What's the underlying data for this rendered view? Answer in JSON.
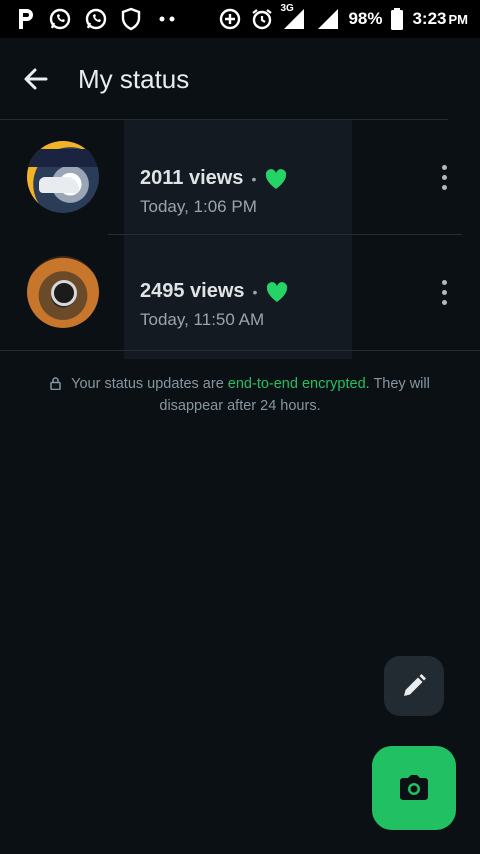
{
  "status_bar": {
    "battery_text": "98%",
    "time": "3:23",
    "time_suffix": "PM",
    "network_label": "3G"
  },
  "header": {
    "title": "My status"
  },
  "statuses": [
    {
      "views": "2011 views",
      "separator": "•",
      "time": "Today, 1:06 PM"
    },
    {
      "views": "2495 views",
      "separator": "•",
      "time": "Today, 11:50 AM"
    }
  ],
  "encryption_note": {
    "before": "Your status updates are ",
    "link": "end-to-end encrypted.",
    "after": " They will disappear after 24 hours."
  },
  "colors": {
    "background": "#0b1014",
    "accent": "#21c063",
    "heart": "#25d366"
  },
  "icons": {
    "back": "arrow-left-icon",
    "more": "more-vertical-icon",
    "pencil": "pencil-icon",
    "camera": "camera-icon",
    "lock": "lock-icon",
    "heart": "heart-icon"
  }
}
